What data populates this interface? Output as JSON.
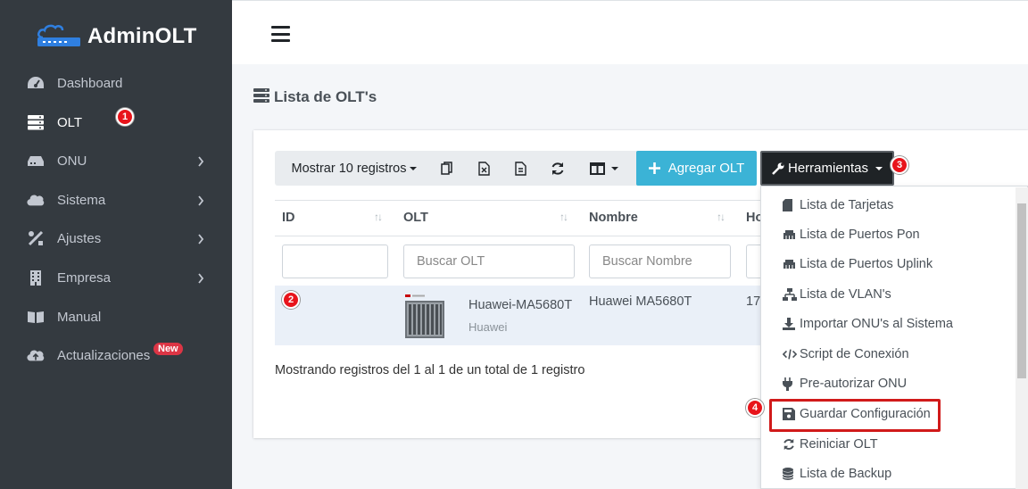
{
  "brand": {
    "name": "AdminOLT",
    "color": "#2f7fe0"
  },
  "sidebar": {
    "items": [
      {
        "label": "Dashboard",
        "icon": "dashboard-icon"
      },
      {
        "label": "OLT",
        "icon": "server-icon",
        "active": true
      },
      {
        "label": "ONU",
        "icon": "router-icon",
        "chevron": true
      },
      {
        "label": "Sistema",
        "icon": "cloud-icon",
        "chevron": true
      },
      {
        "label": "Ajustes",
        "icon": "tools-icon",
        "chevron": true
      },
      {
        "label": "Empresa",
        "icon": "building-icon",
        "chevron": true
      },
      {
        "label": "Manual",
        "icon": "book-icon"
      },
      {
        "label": "Actualizaciones",
        "icon": "cloud-upload-icon",
        "badge": "New"
      }
    ]
  },
  "steps": {
    "s1": "1",
    "s2": "2",
    "s3": "3",
    "s4": "4"
  },
  "page": {
    "title": "Lista de OLT's"
  },
  "toolbar": {
    "show_label": "Mostrar 10 registros",
    "add_label": "Agregar OLT",
    "tools_label": "Herramientas"
  },
  "table": {
    "headers": [
      "ID",
      "OLT",
      "Nombre",
      "Ho"
    ],
    "filters": {
      "id": "",
      "olt_placeholder": "Buscar OLT",
      "nombre_placeholder": "Buscar Nombre"
    },
    "rows": [
      {
        "id": "",
        "olt_name": "Huawei-MA5680T",
        "olt_brand": "Huawei",
        "nombre": "Huawei MA5680T",
        "host": "17"
      }
    ],
    "footer": "Mostrando registros del 1 al 1 de un total de 1 registro"
  },
  "dropdown": {
    "items": [
      {
        "label": "Lista de Tarjetas",
        "icon": "sd-card-icon"
      },
      {
        "label": "Lista de Puertos Pon",
        "icon": "ethernet-icon"
      },
      {
        "label": "Lista de Puertos Uplink",
        "icon": "ethernet-icon"
      },
      {
        "label": "Lista de VLAN's",
        "icon": "network-icon"
      },
      {
        "label": "Importar ONU's al Sistema",
        "icon": "download-icon"
      },
      {
        "label": "Script de Conexión",
        "icon": "code-icon"
      },
      {
        "label": "Pre-autorizar ONU",
        "icon": "plug-icon"
      },
      {
        "label": "Guardar Configuración",
        "icon": "save-icon"
      },
      {
        "label": "Reiniciar OLT",
        "icon": "sync-icon"
      },
      {
        "label": "Lista de Backup",
        "icon": "database-icon"
      }
    ]
  }
}
